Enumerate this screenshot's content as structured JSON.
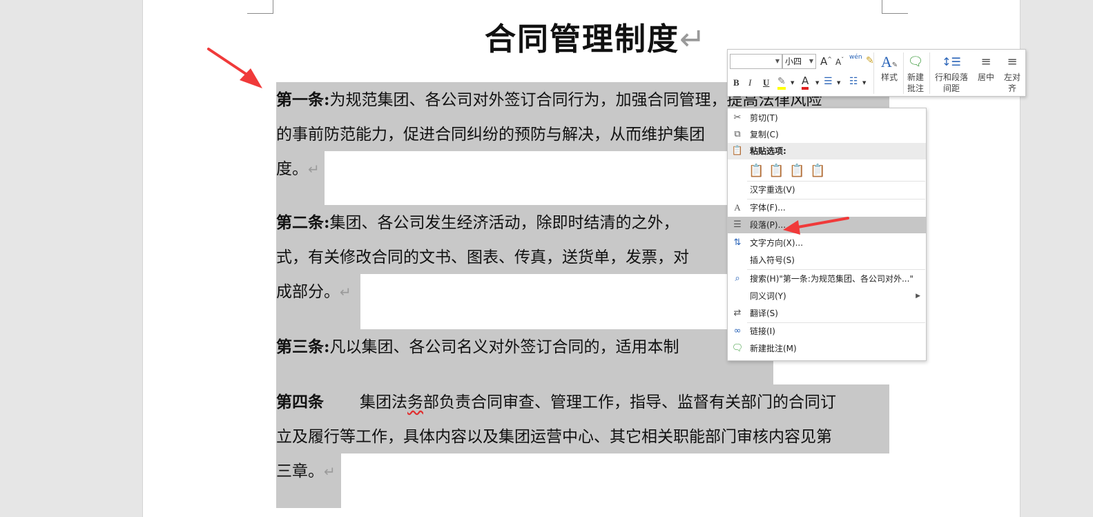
{
  "document": {
    "title": "合同管理制度",
    "paragraph_mark": "↵",
    "paragraphs": [
      {
        "lines": [
          {
            "bold": "第一条:",
            "text": "为规范集团、各公司对外签订合同行为，加强合同管理，提高法律风险"
          },
          {
            "bold": "",
            "text": "的事前防范能力，促进合同纠纷的预防与解决，从而维护集团"
          },
          {
            "bold": "",
            "text": "度。"
          }
        ]
      },
      {
        "lines": [
          {
            "bold": "第二条:",
            "text": "集团、各公司发生经济活动，除即时结清的之外，"
          },
          {
            "bold": "",
            "text": "式，有关修改合同的文书、图表、传真，送货单，发票，对"
          },
          {
            "bold": "",
            "text": "成部分。"
          }
        ]
      },
      {
        "lines": [
          {
            "bold": "第三条:",
            "text": "凡以集团、各公司名义对外签订合同的，适用本制"
          }
        ]
      },
      {
        "lines": [
          {
            "bold": "第四条",
            "text_before": "集团法",
            "text_squiggle": "务",
            "text_after": "部负责合同审查、管理工作，指导、监督有关部门的合同订"
          },
          {
            "bold": "",
            "text": "立及履行等工作，具体内容以及集团运营中心、其它相关职能部门审核内容见第"
          },
          {
            "bold": "",
            "text": "三章。"
          }
        ]
      }
    ]
  },
  "mini_toolbar": {
    "font_name": "",
    "font_size": "小四",
    "grow_font": "A",
    "shrink_font": "A",
    "phonetic": "wén",
    "bold": "B",
    "italic": "I",
    "underline": "U",
    "font_color_glyph": "A",
    "styles_label": "样式",
    "new_comment_label_1": "新建",
    "new_comment_label_2": "批注",
    "line_spacing_label_1": "行和段落",
    "line_spacing_label_2": "间距",
    "center_label": "居中",
    "left_align_label_1": "左对",
    "left_align_label_2": "齐"
  },
  "context_menu": {
    "items": [
      {
        "label": "剪切(T)",
        "icon": "scissors-icon"
      },
      {
        "label": "复制(C)",
        "icon": "copy-icon"
      },
      {
        "label": "粘贴选项:",
        "icon": "paste-icon"
      },
      {
        "label": "汉字重选(V)",
        "icon": ""
      },
      {
        "label": "字体(F)...",
        "icon": "font-icon"
      },
      {
        "label": "段落(P)...",
        "icon": "paragraph-icon"
      },
      {
        "label": "文字方向(X)...",
        "icon": "text-direction-icon"
      },
      {
        "label": "插入符号(S)",
        "icon": ""
      },
      {
        "label": "搜索(H)\"第一条:为规范集团、各公司对外...\"",
        "icon": "search-icon"
      },
      {
        "label": "同义词(Y)",
        "icon": ""
      },
      {
        "label": "翻译(S)",
        "icon": "translate-icon"
      },
      {
        "label": "链接(I)",
        "icon": "link-icon"
      },
      {
        "label": "新建批注(M)",
        "icon": "comment-icon"
      }
    ],
    "paste_options": [
      "keep-source-formatting-icon",
      "merge-formatting-icon",
      "picture-icon",
      "keep-text-only-icon"
    ],
    "submenu_arrow": "▶"
  },
  "colors": {
    "selection": "#c8c8c8",
    "annotation_arrow": "#f03a3a",
    "menu_highlight": "#c6c6c6"
  }
}
